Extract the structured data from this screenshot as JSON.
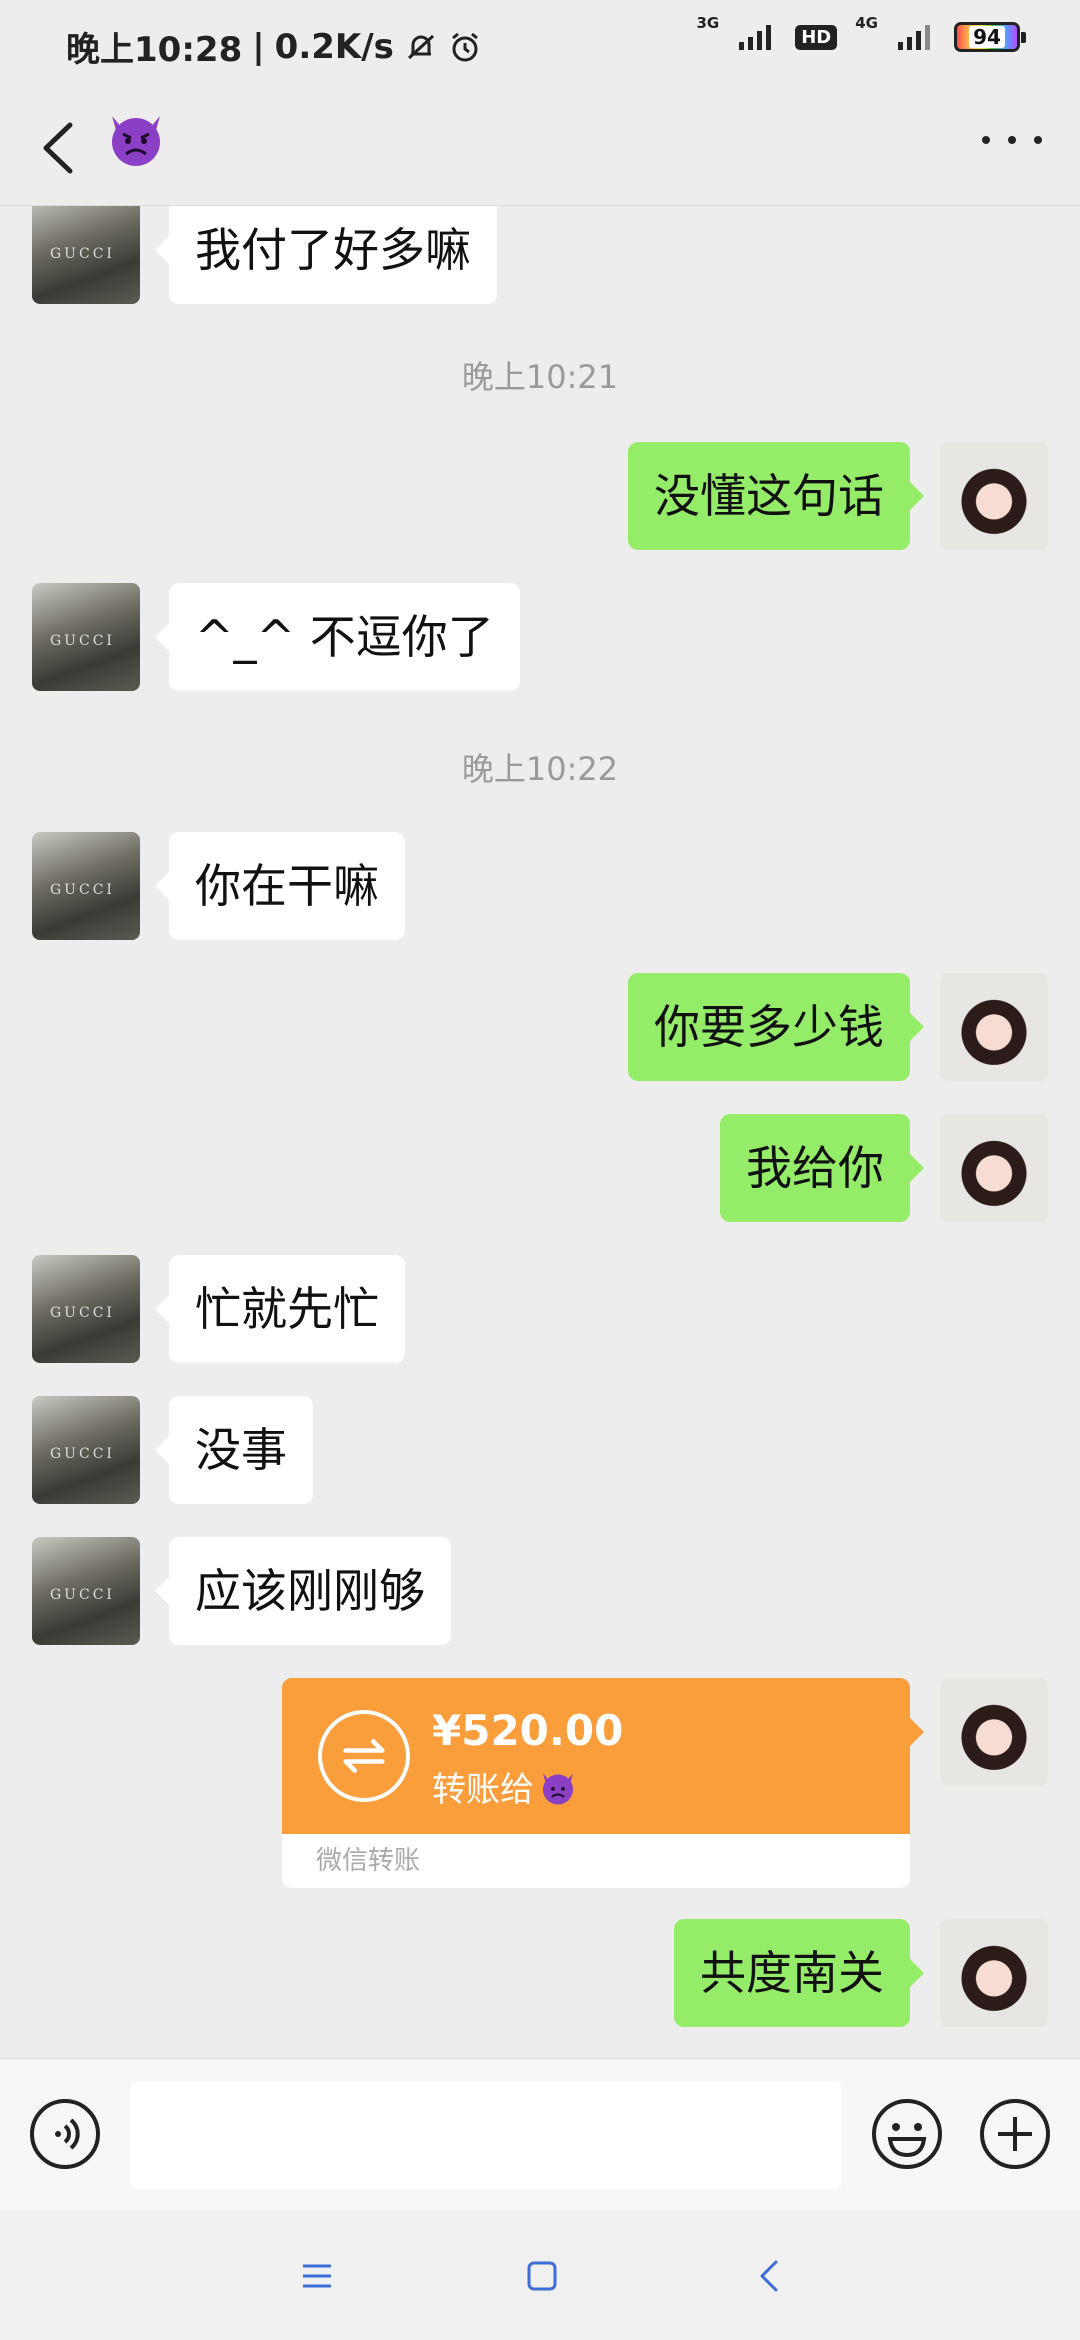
{
  "status_bar": {
    "time": "晚上10:28",
    "separator": "|",
    "speed": "0.2K/s",
    "net1": "3G",
    "hd": "HD",
    "net2": "4G",
    "battery": "94"
  },
  "header": {
    "back_icon": "chevron-left-icon",
    "title_icon": "devil-emoji-icon",
    "more_icon": "more-dots-icon"
  },
  "messages": [
    {
      "side": "left",
      "text": "我付了好多嘛"
    },
    {
      "type": "time",
      "text": "晚上10:21"
    },
    {
      "side": "right",
      "text": "没懂这句话"
    },
    {
      "side": "left",
      "text": "^_^ 不逗你了"
    },
    {
      "type": "time",
      "text": "晚上10:22"
    },
    {
      "side": "left",
      "text": "你在干嘛"
    },
    {
      "side": "right",
      "text": "你要多少钱"
    },
    {
      "side": "right",
      "text": "我给你"
    },
    {
      "side": "left",
      "text": "忙就先忙"
    },
    {
      "side": "left",
      "text": "没事"
    },
    {
      "side": "left",
      "text": "应该刚刚够"
    },
    {
      "side": "right",
      "text": "共度南关"
    }
  ],
  "transfer": {
    "amount": "¥520.00",
    "desc": "转账给",
    "footer": "微信转账",
    "color": "#fa9d3b"
  },
  "input_bar": {
    "placeholder": "",
    "voice_icon": "voice-icon",
    "emoji_icon": "smile-icon",
    "plus_icon": "plus-icon"
  },
  "colors": {
    "background": "#ededed",
    "sent_bubble": "#95ec69",
    "received_bubble": "#ffffff"
  }
}
